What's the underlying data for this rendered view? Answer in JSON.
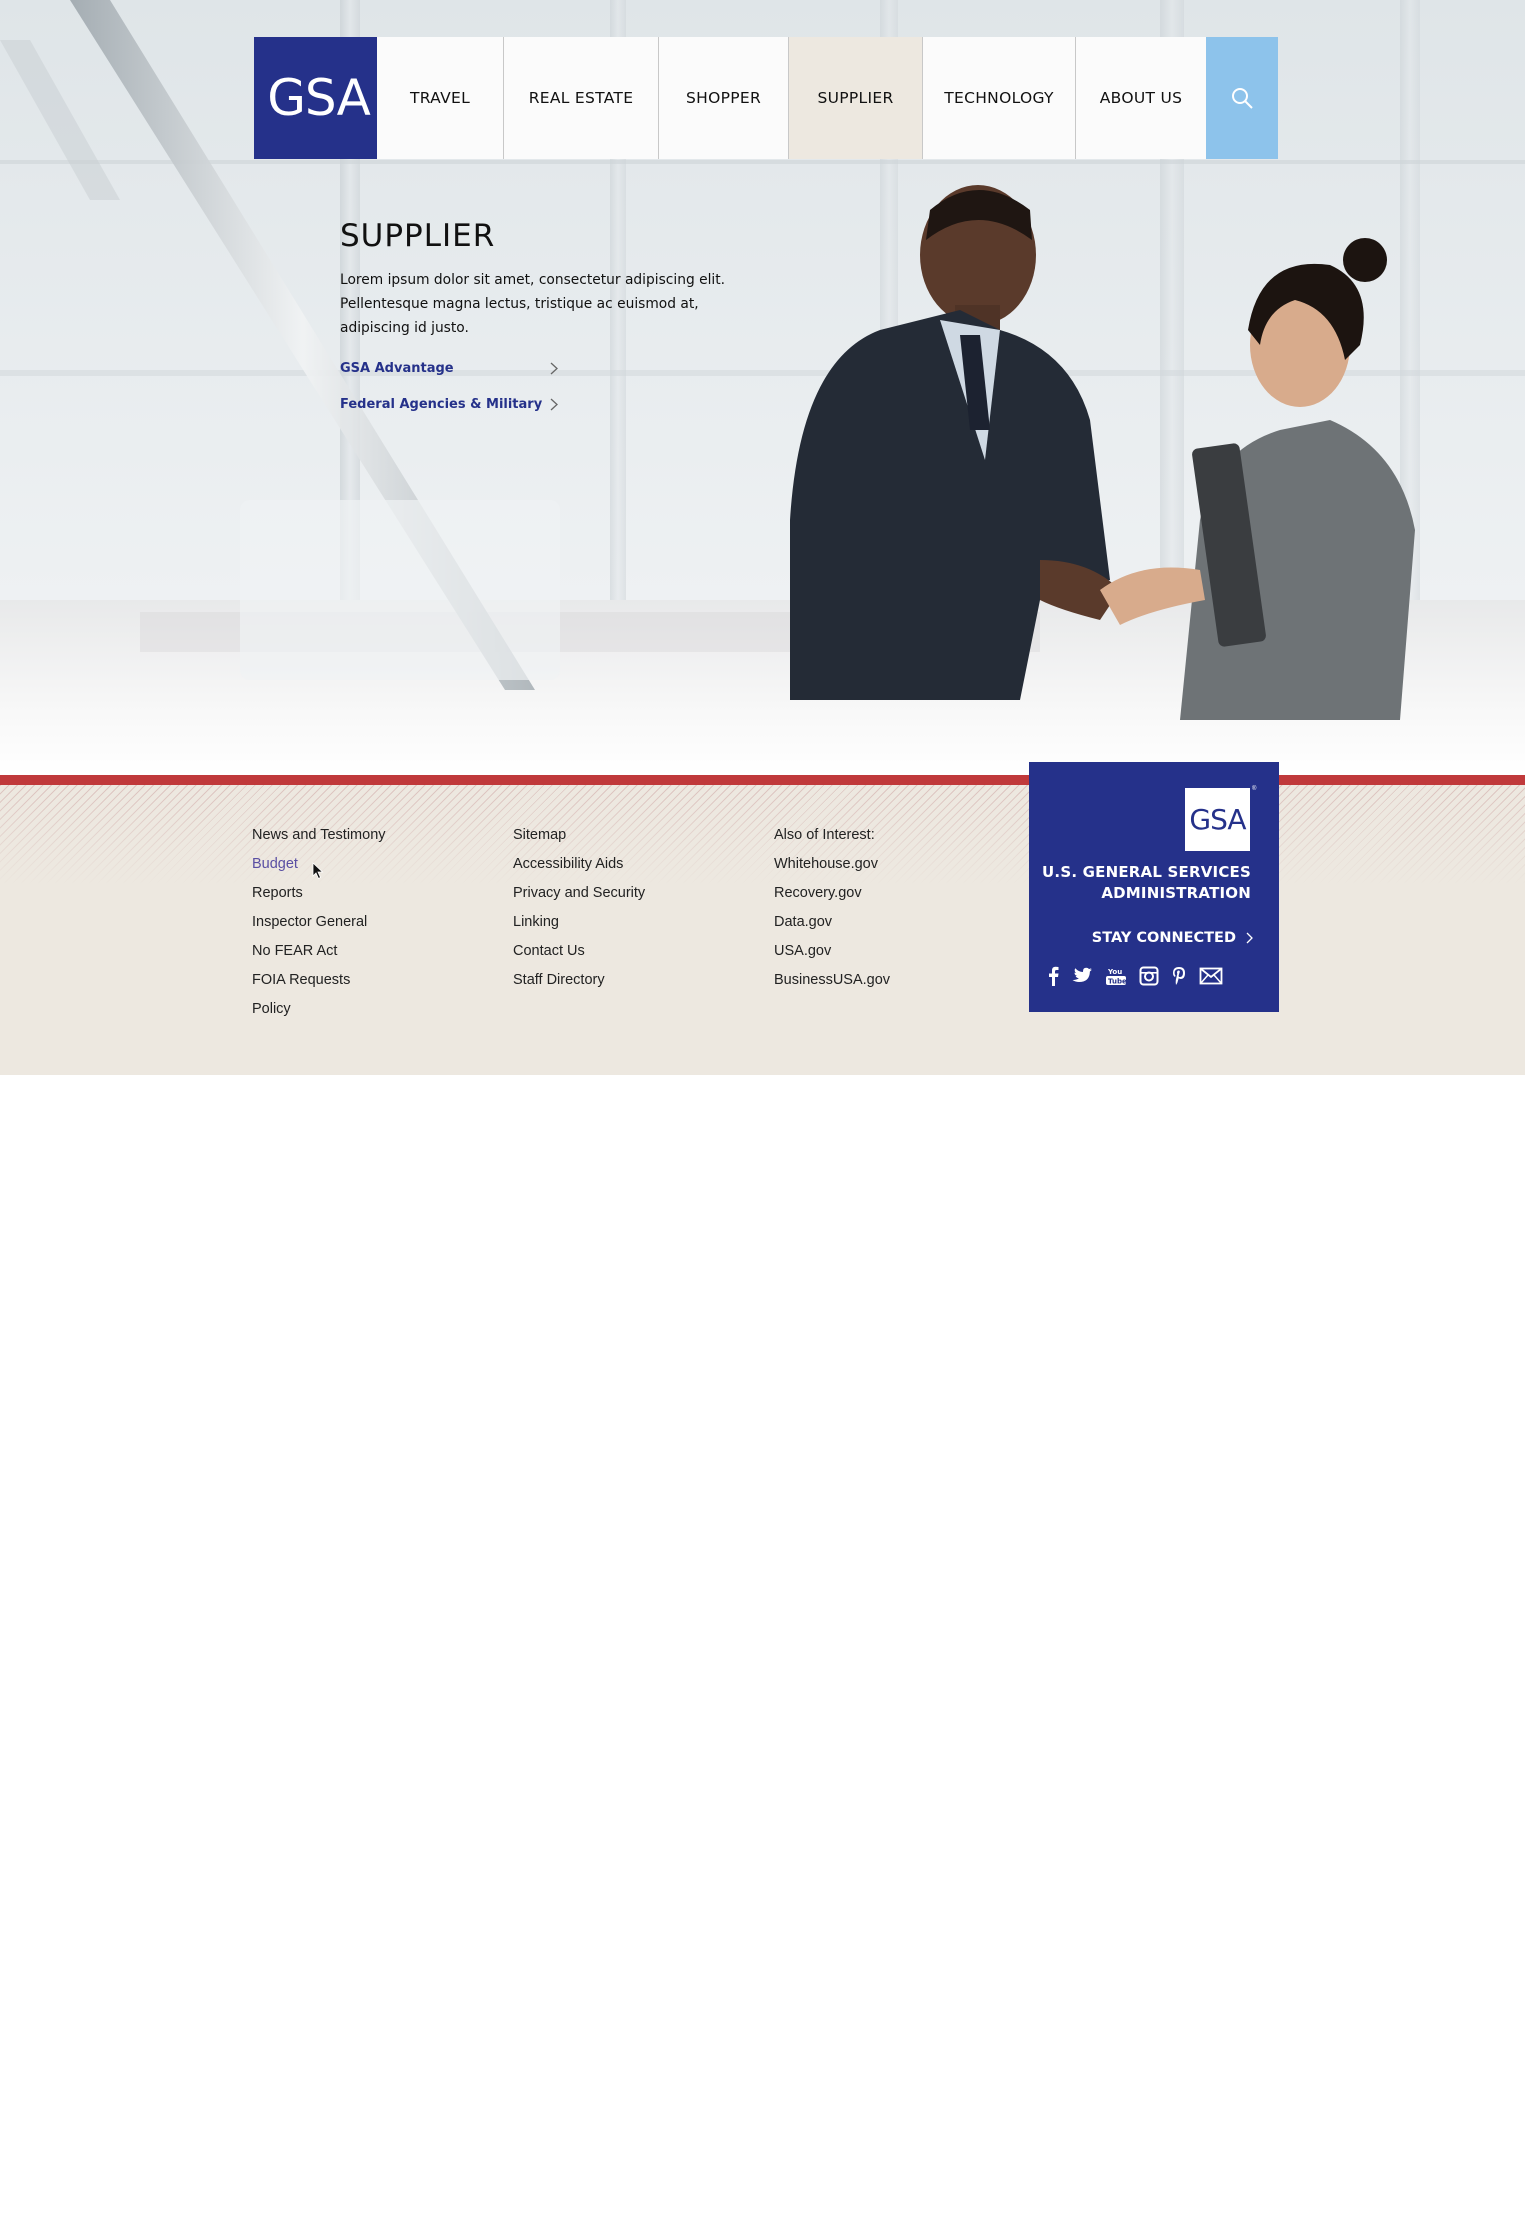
{
  "header": {
    "logo_text": "GSA",
    "nav": [
      {
        "label": "TRAVEL"
      },
      {
        "label": "REAL ESTATE"
      },
      {
        "label": "SHOPPER"
      },
      {
        "label": "SUPPLIER",
        "active": true
      },
      {
        "label": "TECHNOLOGY"
      },
      {
        "label": "ABOUT US"
      }
    ],
    "search_icon": "search-icon"
  },
  "hero": {
    "title": "SUPPLIER",
    "body": "Lorem ipsum dolor sit amet, consectetur adipiscing elit. Pellentesque magna lectus, tristique ac euismod at, adipiscing id justo.",
    "links": [
      {
        "label": "GSA Advantage"
      },
      {
        "label": "Federal Agencies & Military"
      }
    ]
  },
  "footer": {
    "col1": [
      "News and Testimony",
      "Budget",
      "Reports",
      "Inspector General",
      "No FEAR Act",
      "FOIA Requests",
      "Policy"
    ],
    "col2": [
      "Sitemap",
      "Accessibility Aids",
      "Privacy and Security",
      "Linking",
      "Contact Us",
      "Staff Directory"
    ],
    "col3": [
      "Also of Interest:",
      "Whitehouse.gov",
      "Recovery.gov",
      "Data.gov",
      "USA.gov",
      "BusinessUSA.gov"
    ],
    "hovered_link": "Budget"
  },
  "brand": {
    "logo_text": "GSA",
    "registered": "®",
    "name_line1": "U.S. GENERAL SERVICES",
    "name_line2": "ADMINISTRATION",
    "stay_connected": "STAY CONNECTED",
    "social_icons": [
      "facebook-icon",
      "twitter-icon",
      "youtube-icon",
      "instagram-icon",
      "pinterest-icon",
      "email-icon"
    ]
  },
  "colors": {
    "brand_blue": "#25318a",
    "search_blue": "#8dc3eb",
    "footer_red": "#c0393b",
    "footer_bg": "#ede8e0",
    "nav_active_bg": "#ede8e0"
  }
}
